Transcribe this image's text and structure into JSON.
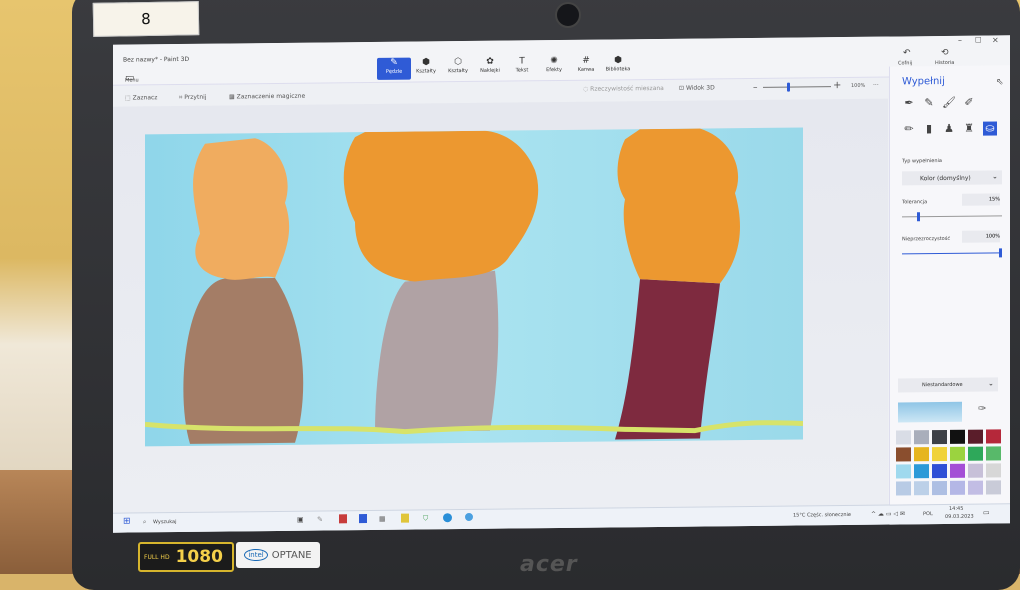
{
  "sticker": {
    "number": "8"
  },
  "app": {
    "title": "Bez nazwy* - Paint 3D",
    "menu_label": "Menu",
    "undo_label": "Cofnij",
    "history_label": "Historia",
    "window_controls": {
      "min": "–",
      "max": "□",
      "close": "×"
    }
  },
  "toolbar": {
    "items": [
      {
        "label": "Pędzle",
        "glyph": "✎"
      },
      {
        "label": "Kształty",
        "glyph": "⬢"
      },
      {
        "label": "Kształty",
        "glyph": "⬡"
      },
      {
        "label": "Naklejki",
        "glyph": "✿"
      },
      {
        "label": "Tekst",
        "glyph": "T"
      },
      {
        "label": "Efekty",
        "glyph": "✺"
      },
      {
        "label": "Kanwa",
        "glyph": "#"
      },
      {
        "label": "Biblioteka",
        "glyph": "⬢"
      }
    ]
  },
  "subbar": {
    "select": "Zaznacz",
    "crop": "Przytnij",
    "magic_select": "Zaznaczenie magiczne",
    "mixed_reality": "Rzeczywistość mieszana",
    "view3d": "Widok 3D",
    "zoom": "100%",
    "more": "···"
  },
  "panel": {
    "title": "Wypełnij",
    "fill_type_label": "Typ wypełnienia",
    "fill_type_value": "Kolor (domyślny)",
    "tolerance_label": "Tolerancja",
    "tolerance_value": "15%",
    "tolerance_level": 0.15,
    "opacity_label": "Nieprzezroczystość",
    "opacity_value": "100%",
    "opacity_level": 1.0,
    "finish_label": "Niestandardowe",
    "eyedropper_icon": "eyedropper-icon",
    "palette": [
      "#d9dde6",
      "#a9aebb",
      "#3d4047",
      "#111111",
      "#5a1d2a",
      "#b5283a",
      "#8a4e2e",
      "#e6b51f",
      "#f0d23a",
      "#9bd33f",
      "#2ea85a",
      "#58b96a",
      "#9fd9ee",
      "#2c9ad8",
      "#2f4fd6",
      "#a44fd6",
      "#c7c0d8",
      "#d7d7d7",
      "#b8cbe5",
      "#bcd0e8",
      "#aebfe3",
      "#b4b7e6",
      "#c2bde4",
      "#c9cbd8"
    ]
  },
  "taskbar": {
    "search": "Wyszukaj",
    "weather": "15°C Częśc. słonecznie",
    "lang": "POL",
    "time": "14:45",
    "date": "09.03.2023"
  },
  "bezel": {
    "hd_label": "FULL HD",
    "hd_value": "1080",
    "intel_label": "OPTANE",
    "intel_sub": "MEMORY",
    "intel_brand": "intel",
    "acer": "acer"
  }
}
